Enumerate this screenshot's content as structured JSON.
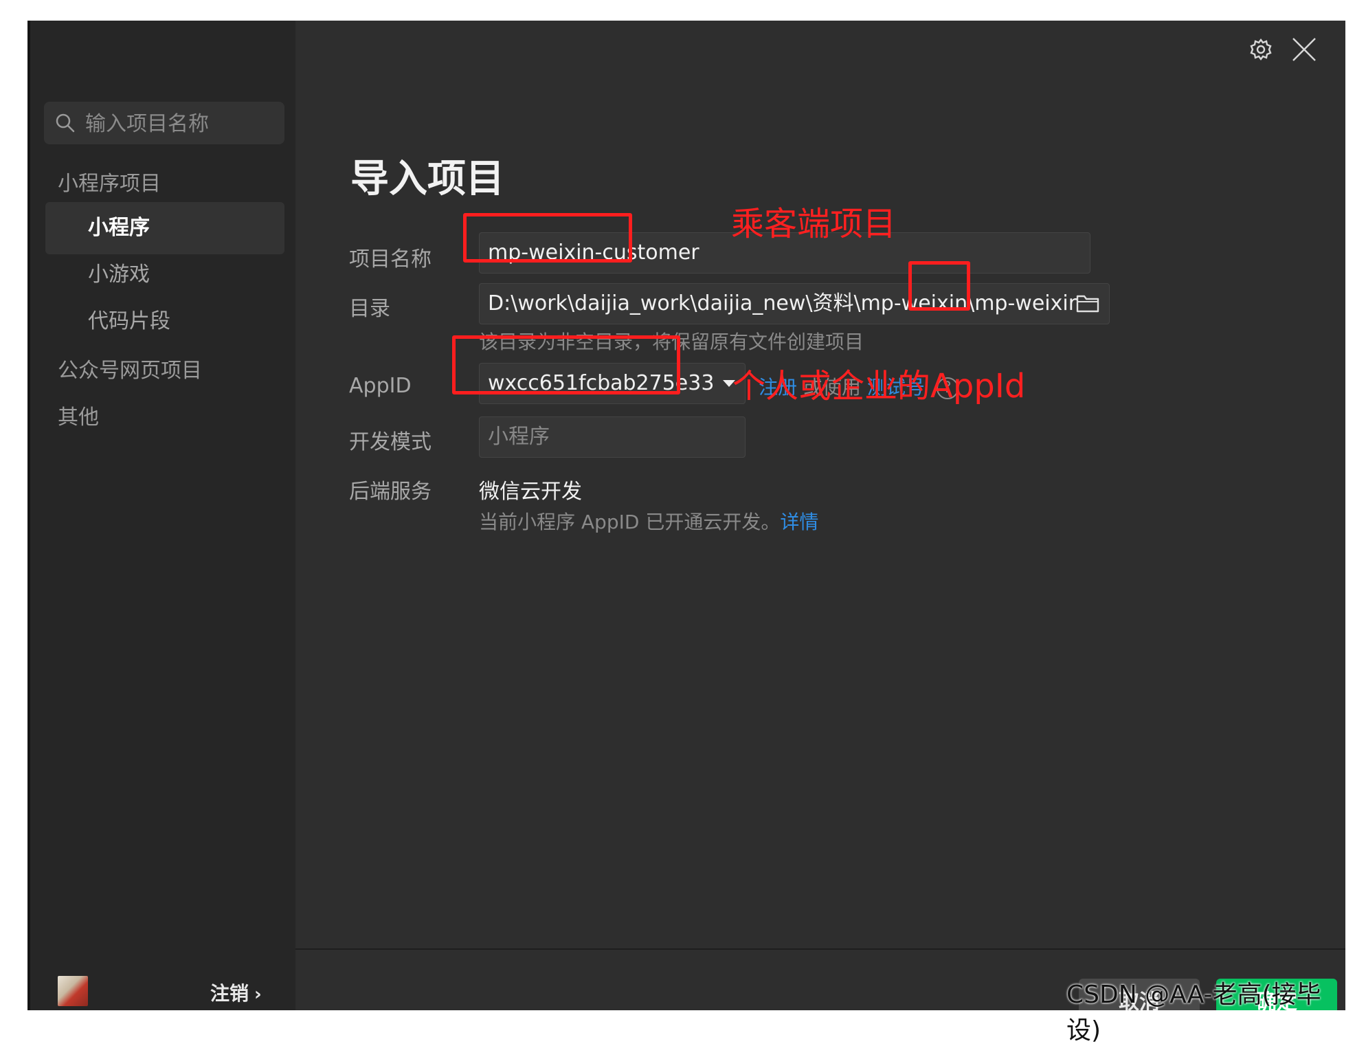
{
  "sidebar": {
    "search_placeholder": "输入项目名称",
    "group_miniprogram": "小程序项目",
    "items": [
      {
        "label": "小程序"
      },
      {
        "label": "小游戏"
      },
      {
        "label": "代码片段"
      }
    ],
    "group_official": "公众号网页项目",
    "group_other": "其他",
    "logout_label": "注销",
    "logout_chevron": "›"
  },
  "dialog": {
    "title": "导入项目",
    "fields": {
      "name_label": "项目名称",
      "name_value": "mp-weixin-customer",
      "dir_label": "目录",
      "dir_value": "D:\\work\\daijia_work\\daijia_new\\资料\\mp-weixin\\mp-weixir",
      "dir_hint": "该目录为非空目录，将保留原有文件创建项目",
      "appid_label": "AppID",
      "appid_value": "wxcc651fcbab275e33",
      "register_link": "注册",
      "or_use_text": "或使用",
      "test_account_link": "测试号",
      "help_glyph": "?",
      "devmode_label": "开发模式",
      "devmode_value": "小程序",
      "backend_label": "后端服务",
      "backend_value": "微信云开发",
      "backend_hint": "当前小程序 AppID 已开通云开发。",
      "details_link": "详情"
    },
    "buttons": {
      "cancel": "取消",
      "confirm": "确定"
    }
  },
  "annotations": {
    "project_note": "乘客端项目",
    "appid_note": "个人或企业的AppId",
    "color": "#ff1e1e"
  },
  "watermark": "CSDN @AA-老高(接毕设)",
  "colors": {
    "accent_green": "#07c160",
    "link_blue": "#2f8de4",
    "background": "#2e2e2e",
    "sidebar": "#262626"
  }
}
